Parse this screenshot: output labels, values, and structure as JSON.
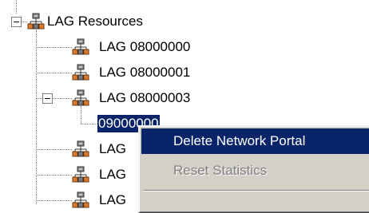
{
  "tree": {
    "root": {
      "label": "LAG Resources",
      "expanded": true,
      "icon": "network-group-icon"
    },
    "children": [
      {
        "label": "LAG 08000000",
        "icon": "network-group-icon"
      },
      {
        "label": "LAG 08000001",
        "icon": "network-group-icon"
      },
      {
        "label": "LAG 08000003",
        "icon": "network-group-icon",
        "expanded": true,
        "children": [
          {
            "label": "09000000",
            "selected": true
          }
        ]
      },
      {
        "label": "LAG",
        "icon": "network-group-icon"
      },
      {
        "label": "LAG",
        "icon": "network-group-icon"
      },
      {
        "label": "LAG",
        "icon": "network-group-icon"
      }
    ]
  },
  "context_menu": {
    "items": [
      {
        "label": "Delete Network Portal",
        "state": "highlighted"
      },
      {
        "label": "Reset Statistics",
        "state": "disabled"
      }
    ]
  },
  "colors": {
    "selection": "#0a246a",
    "menu_face": "#d4d0c8",
    "tree_line": "#7f7f7f"
  }
}
